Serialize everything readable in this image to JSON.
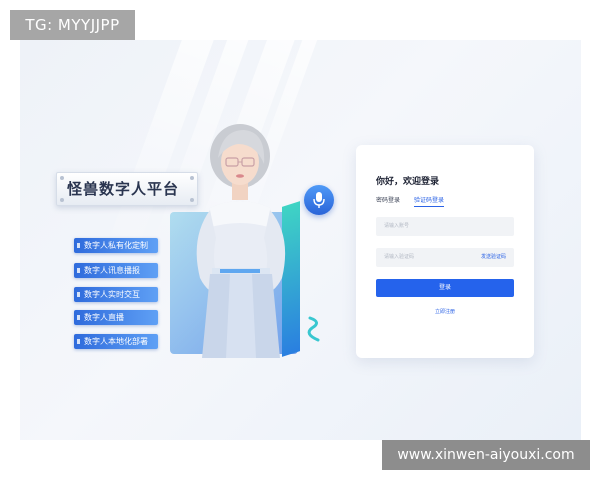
{
  "watermarks": {
    "top_left": "TG: MYYJJPP",
    "bottom_right": "www.xinwen-aiyouxi.com"
  },
  "brand": {
    "title": "怪兽数字人平台"
  },
  "features": [
    {
      "label": "数字人私有化定制"
    },
    {
      "label": "数字人讯息播报"
    },
    {
      "label": "数字人实时交互"
    },
    {
      "label": "数字人直播"
    },
    {
      "label": "数字人本地化部署"
    }
  ],
  "illustration": {
    "mic_icon": "microphone-icon",
    "avatar": "digital-human-avatar"
  },
  "login": {
    "greeting": "你好，欢迎登录",
    "tabs": [
      {
        "label": "密码登录",
        "active": false
      },
      {
        "label": "验证码登录",
        "active": true
      }
    ],
    "phone_placeholder": "请输入账号",
    "code_placeholder": "请输入验证码",
    "send_code_label": "发送验证码",
    "submit_label": "登录",
    "register_label": "立即注册",
    "accent_color": "#2563ec"
  }
}
